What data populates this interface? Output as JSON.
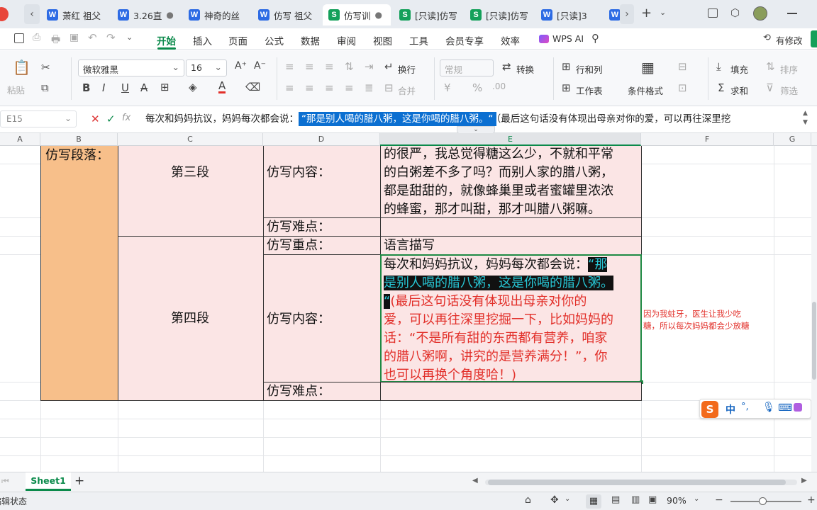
{
  "tabs": [
    {
      "label": "萧红 祖父",
      "icon": "W",
      "color": "#2d6be4"
    },
    {
      "label": "3.26直",
      "icon": "W",
      "color": "#2d6be4"
    },
    {
      "label": "神奇的丝",
      "icon": "W",
      "color": "#2d6be4"
    },
    {
      "label": "仿写 祖父",
      "icon": "W",
      "color": "#2d6be4"
    },
    {
      "label": "仿写训",
      "icon": "S",
      "color": "#14a05a"
    },
    {
      "label": "[只读]仿写",
      "icon": "S",
      "color": "#14a05a"
    },
    {
      "label": "[只读]仿写",
      "icon": "S",
      "color": "#14a05a"
    },
    {
      "label": "[只读]3",
      "icon": "W",
      "color": "#2d6be4"
    },
    {
      "label": "W",
      "icon": "W",
      "color": "#2d6be4"
    }
  ],
  "menu": [
    "开始",
    "插入",
    "页面",
    "公式",
    "数据",
    "审阅",
    "视图",
    "工具",
    "会员专享",
    "效率"
  ],
  "wps_ai": "WPS AI",
  "has_changes": "有修改",
  "ribbon": {
    "paste": "粘贴",
    "font": "微软雅黑",
    "size": "16",
    "wrap": "换行",
    "merge": "合并",
    "format": "常规",
    "convert": "转换",
    "rowcol": "行和列",
    "worksheet": "工作表",
    "condfmt": "条件格式",
    "fill": "填充",
    "sort": "排序",
    "sum": "求和",
    "filter": "筛选"
  },
  "formula_bar": {
    "cell_ref": "E15",
    "fx": "fx",
    "text_before": "每次和妈妈抗议，妈妈每次都会说：",
    "text_selected": "“那是别人喝的腊八粥，这是你喝的腊八粥。“",
    "text_after": "（最后这句话没有体现出母亲对你的爱，可以再往深里挖"
  },
  "columns": [
    "A",
    "B",
    "C",
    "D",
    "E",
    "F",
    "G"
  ],
  "cells": {
    "b_label": "仿写段落：",
    "c_third": "第三段",
    "c_fourth": "第四段",
    "d_content1": "仿写内容：",
    "d_difficulty1": "仿写难点：",
    "d_key": "仿写重点：",
    "d_content2": "仿写内容：",
    "d_difficulty2": "仿写难点：",
    "e_content1": [
      "的很严，我总觉得糖这么少，不就和平常",
      "的白粥差不多了吗？而别人家的腊八粥，",
      "都是甜甜的，就像蜂巢里或者蜜罐里浓浓",
      "的蜂蜜，那才叫甜，那才叫腊八粥嘛。"
    ],
    "e_key": "语言描写",
    "e15_line1a": "每次和妈妈抗议，妈妈每次都会说：",
    "e15_line1b": "“那",
    "e15_line2": "是别人喝的腊八粥，这是你喝的腊八粥。",
    "e15_line3a": "“",
    "e15_line3b": "(最后这句话没有体现出母亲对你的",
    "e15_red": [
      "爱，可以再往深里挖掘一下，比如妈妈的",
      "话：“不是所有甜的东西都有营养，咱家",
      "的腊八粥啊，讲究的是营养满分！”，你",
      "也可以再换个角度哈！)"
    ],
    "comment": [
      "因为我蛀牙，医生让我少吃",
      "糖，所以每次妈妈都会少放糖"
    ]
  },
  "ime": {
    "lang": "中",
    "punct": "°,"
  },
  "sheet": "Sheet1",
  "status_left": "编辑状态",
  "zoom": "90%",
  "colors": {
    "accent_green": "#0b8a4b",
    "pink": "#fbe5e5",
    "orange": "#f7bf8a",
    "red": "#e2302a",
    "selection": "#0b6fd1"
  }
}
